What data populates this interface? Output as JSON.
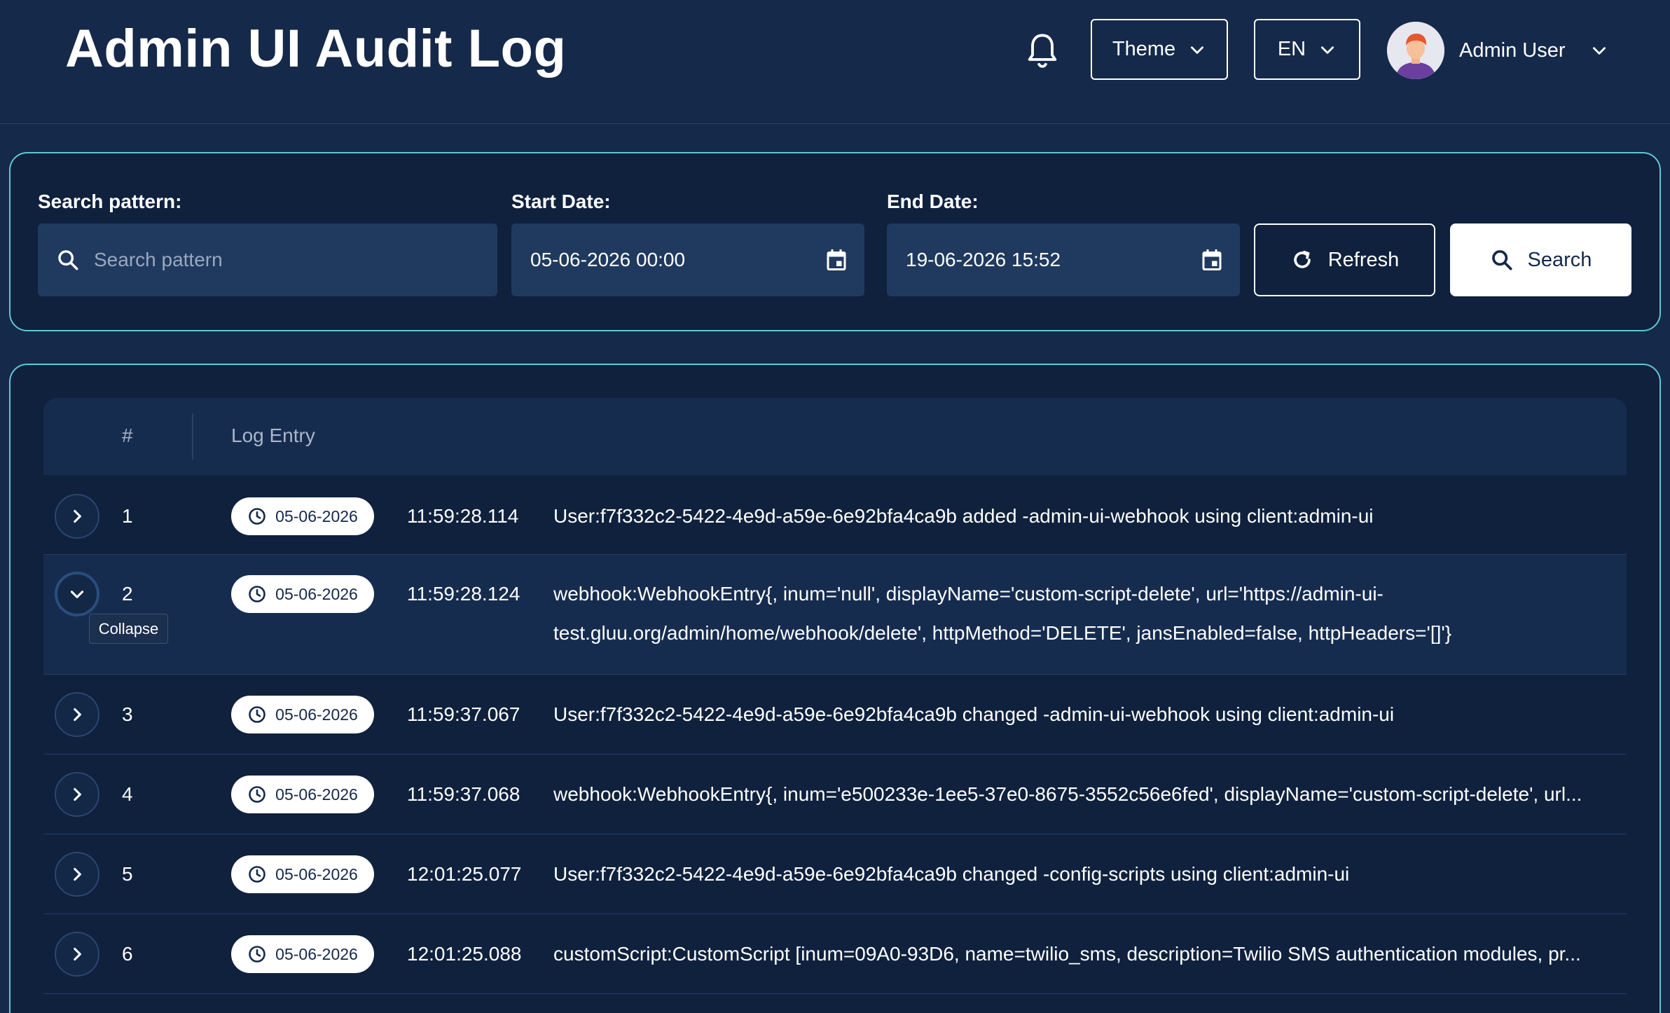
{
  "header": {
    "title": "Admin UI Audit Log",
    "theme_label": "Theme",
    "language_label": "EN",
    "user_name": "Admin User"
  },
  "filters": {
    "search_label": "Search pattern:",
    "search_placeholder": "Search pattern",
    "start_label": "Start Date:",
    "start_value": "05-06-2026 00:00",
    "end_label": "End Date:",
    "end_value": "19-06-2026 15:52",
    "refresh_label": "Refresh",
    "search_button_label": "Search"
  },
  "table": {
    "col_num": "#",
    "col_log": "Log Entry",
    "tooltip": "Collapse",
    "rows": [
      {
        "num": "1",
        "date": "05-06-2026",
        "time": "11:59:28.114",
        "msg": "User:f7f332c2-5422-4e9d-a59e-6e92bfa4ca9b added -admin-ui-webhook using client:admin-ui"
      },
      {
        "num": "2",
        "date": "05-06-2026",
        "time": "11:59:28.124",
        "msg": "webhook:WebhookEntry{, inum='null', displayName='custom-script-delete', url='https://admin-ui-test.gluu.org/admin/home/webhook/delete', httpMethod='DELETE', jansEnabled=false, httpHeaders='[]'}"
      },
      {
        "num": "3",
        "date": "05-06-2026",
        "time": "11:59:37.067",
        "msg": "User:f7f332c2-5422-4e9d-a59e-6e92bfa4ca9b changed -admin-ui-webhook using client:admin-ui"
      },
      {
        "num": "4",
        "date": "05-06-2026",
        "time": "11:59:37.068",
        "msg": "webhook:WebhookEntry{, inum='e500233e-1ee5-37e0-8675-3552c56e6fed', displayName='custom-script-delete', url..."
      },
      {
        "num": "5",
        "date": "05-06-2026",
        "time": "12:01:25.077",
        "msg": "User:f7f332c2-5422-4e9d-a59e-6e92bfa4ca9b changed -config-scripts using client:admin-ui"
      },
      {
        "num": "6",
        "date": "05-06-2026",
        "time": "12:01:25.088",
        "msg": "customScript:CustomScript [inum=09A0-93D6, name=twilio_sms, description=Twilio SMS authentication modules, pr..."
      }
    ]
  },
  "colors": {
    "background": "#15294a",
    "panel": "#0f213d",
    "accent_border": "#5fc7d6"
  },
  "icons": [
    "bell-icon",
    "chevron-down-icon",
    "search-icon",
    "calendar-icon",
    "refresh-icon",
    "clock-icon",
    "chevron-right-icon",
    "avatar"
  ]
}
